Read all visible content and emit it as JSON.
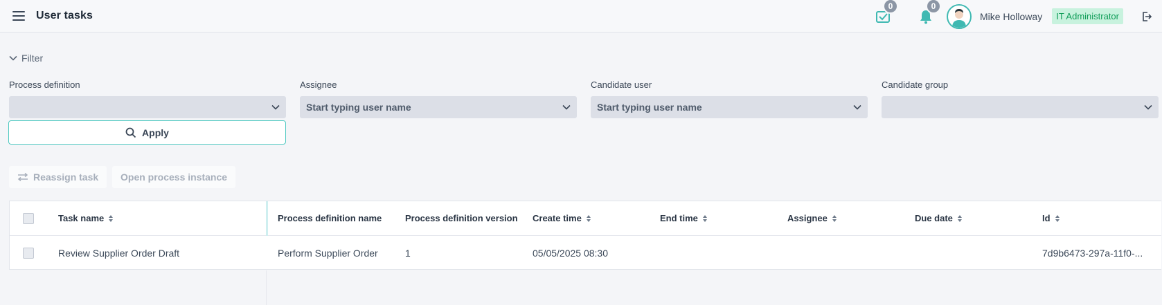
{
  "header": {
    "title": "User tasks",
    "tasks_badge": "0",
    "notifications_badge": "0",
    "user_name": "Mike Holloway",
    "role": "IT Administrator"
  },
  "filter": {
    "toggle_label": "Filter",
    "fields": [
      {
        "label": "Process definition",
        "placeholder": ""
      },
      {
        "label": "Assignee",
        "placeholder": "Start typing user name"
      },
      {
        "label": "Candidate user",
        "placeholder": "Start typing user name"
      },
      {
        "label": "Candidate group",
        "placeholder": ""
      }
    ],
    "apply_label": "Apply"
  },
  "actions": {
    "reassign_label": "Reassign task",
    "open_process_label": "Open process instance"
  },
  "table": {
    "columns": [
      "Task name",
      "Process definition name",
      "Process definition version",
      "Create time",
      "End time",
      "Assignee",
      "Due date",
      "Id"
    ],
    "rows": [
      {
        "task_name": "Review Supplier Order Draft",
        "process_definition_name": "Perform Supplier Order",
        "process_definition_version": "1",
        "create_time": "05/05/2025 08:30",
        "end_time": "",
        "assignee": "",
        "due_date": "",
        "id": "7d9b6473-297a-11f0-..."
      }
    ]
  },
  "colors": {
    "accent": "#4fc9c1",
    "role_bg": "#c8f2de",
    "role_text": "#0f9d58",
    "icon_teal": "#3fb9b2"
  }
}
